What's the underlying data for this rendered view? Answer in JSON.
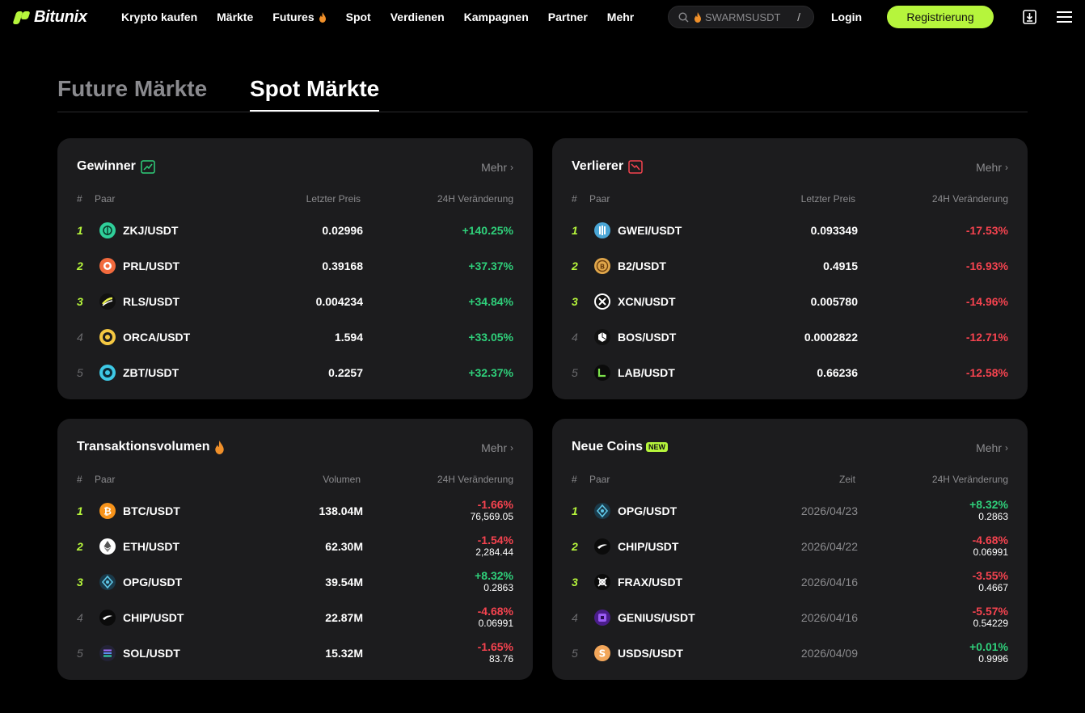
{
  "brand": {
    "name": "Bitunix",
    "accent": "#b6f53c"
  },
  "nav": {
    "links": [
      "Krypto kaufen",
      "Märkte",
      "Futures",
      "Spot",
      "Verdienen",
      "Kampagnen",
      "Partner",
      "Mehr"
    ],
    "search_placeholder": "SWARMSUSDT",
    "search_shortcut": "/",
    "login": "Login",
    "register": "Registrierung"
  },
  "tabs": {
    "future": "Future Märkte",
    "spot": "Spot Märkte",
    "active": "spot"
  },
  "colors": {
    "up": "#2fcf7a",
    "down": "#f5434f",
    "card": "#1c1c1e"
  },
  "gewinner": {
    "title": "Gewinner",
    "icon": "trend-up-icon",
    "more": "Mehr",
    "headers": {
      "rank": "#",
      "pair": "Paar",
      "col3": "Letzter Preis",
      "change": "24H Veränderung"
    },
    "rows": [
      {
        "rank": "1",
        "pair": "ZKJ/USDT",
        "icon": "zkj-coin-icon",
        "price": "0.02996",
        "change": "+140.25%"
      },
      {
        "rank": "2",
        "pair": "PRL/USDT",
        "icon": "prl-coin-icon",
        "price": "0.39168",
        "change": "+37.37%"
      },
      {
        "rank": "3",
        "pair": "RLS/USDT",
        "icon": "rls-coin-icon",
        "price": "0.004234",
        "change": "+34.84%"
      },
      {
        "rank": "4",
        "pair": "ORCA/USDT",
        "icon": "orca-coin-icon",
        "price": "1.594",
        "change": "+33.05%"
      },
      {
        "rank": "5",
        "pair": "ZBT/USDT",
        "icon": "zbt-coin-icon",
        "price": "0.2257",
        "change": "+32.37%"
      }
    ]
  },
  "verlierer": {
    "title": "Verlierer",
    "icon": "trend-down-icon",
    "more": "Mehr",
    "headers": {
      "rank": "#",
      "pair": "Paar",
      "col3": "Letzter Preis",
      "change": "24H Veränderung"
    },
    "rows": [
      {
        "rank": "1",
        "pair": "GWEI/USDT",
        "icon": "gwei-coin-icon",
        "price": "0.093349",
        "change": "-17.53%"
      },
      {
        "rank": "2",
        "pair": "B2/USDT",
        "icon": "b2-coin-icon",
        "price": "0.4915",
        "change": "-16.93%"
      },
      {
        "rank": "3",
        "pair": "XCN/USDT",
        "icon": "xcn-coin-icon",
        "price": "0.005780",
        "change": "-14.96%"
      },
      {
        "rank": "4",
        "pair": "BOS/USDT",
        "icon": "bos-coin-icon",
        "price": "0.0002822",
        "change": "-12.71%"
      },
      {
        "rank": "5",
        "pair": "LAB/USDT",
        "icon": "lab-coin-icon",
        "price": "0.66236",
        "change": "-12.58%"
      }
    ]
  },
  "volumen": {
    "title": "Transaktionsvolumen",
    "icon": "fire-icon",
    "more": "Mehr",
    "headers": {
      "rank": "#",
      "pair": "Paar",
      "col3": "Volumen",
      "change": "24H Veränderung"
    },
    "rows": [
      {
        "rank": "1",
        "pair": "BTC/USDT",
        "icon": "btc-coin-icon",
        "volume": "138.04M",
        "change": "-1.66%",
        "price": "76,569.05",
        "dir": "down"
      },
      {
        "rank": "2",
        "pair": "ETH/USDT",
        "icon": "eth-coin-icon",
        "volume": "62.30M",
        "change": "-1.54%",
        "price": "2,284.44",
        "dir": "down"
      },
      {
        "rank": "3",
        "pair": "OPG/USDT",
        "icon": "opg-coin-icon",
        "volume": "39.54M",
        "change": "+8.32%",
        "price": "0.2863",
        "dir": "up"
      },
      {
        "rank": "4",
        "pair": "CHIP/USDT",
        "icon": "chip-coin-icon",
        "volume": "22.87M",
        "change": "-4.68%",
        "price": "0.06991",
        "dir": "down"
      },
      {
        "rank": "5",
        "pair": "SOL/USDT",
        "icon": "sol-coin-icon",
        "volume": "15.32M",
        "change": "-1.65%",
        "price": "83.76",
        "dir": "down"
      }
    ]
  },
  "neue": {
    "title": "Neue Coins",
    "badge": "NEW",
    "more": "Mehr",
    "headers": {
      "rank": "#",
      "pair": "Paar",
      "col3": "Zeit",
      "change": "24H Veränderung"
    },
    "rows": [
      {
        "rank": "1",
        "pair": "OPG/USDT",
        "icon": "opg-coin-icon",
        "date": "2026/04/23",
        "change": "+8.32%",
        "price": "0.2863",
        "dir": "up"
      },
      {
        "rank": "2",
        "pair": "CHIP/USDT",
        "icon": "chip-coin-icon",
        "date": "2026/04/22",
        "change": "-4.68%",
        "price": "0.06991",
        "dir": "down"
      },
      {
        "rank": "3",
        "pair": "FRAX/USDT",
        "icon": "frax-coin-icon",
        "date": "2026/04/16",
        "change": "-3.55%",
        "price": "0.4667",
        "dir": "down"
      },
      {
        "rank": "4",
        "pair": "GENIUS/USDT",
        "icon": "genius-coin-icon",
        "date": "2026/04/16",
        "change": "-5.57%",
        "price": "0.54229",
        "dir": "down"
      },
      {
        "rank": "5",
        "pair": "USDS/USDT",
        "icon": "usds-coin-icon",
        "date": "2026/04/09",
        "change": "+0.01%",
        "price": "0.9996",
        "dir": "up"
      }
    ]
  }
}
